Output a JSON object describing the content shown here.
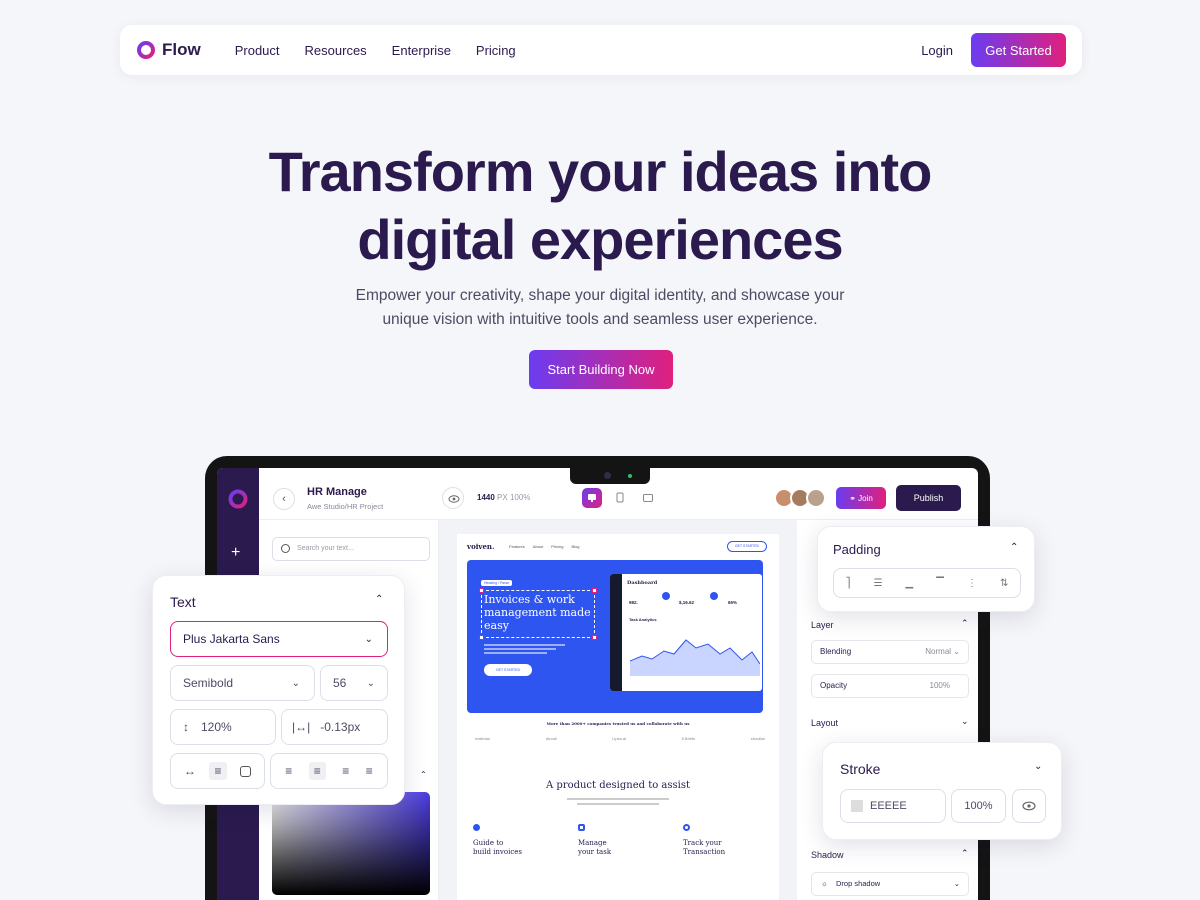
{
  "nav": {
    "brand": "Flow",
    "links": [
      "Product",
      "Resources",
      "Enterprise",
      "Pricing"
    ],
    "login": "Login",
    "cta": "Get Started"
  },
  "hero": {
    "title_line1": "Transform your ideas into",
    "title_line2": "digital experiences",
    "subtitle_line1": "Empower your creativity, shape your digital identity, and showcase your",
    "subtitle_line2": "unique vision with intuitive tools and seamless user experience.",
    "cta": "Start Building Now"
  },
  "editor": {
    "project_title": "HR Manage",
    "project_path": "Awe Studio/HR Project",
    "width_value": "1440",
    "width_unit": "PX",
    "zoom": "100%",
    "join": "Join",
    "publish": "Publish",
    "search_placeholder": "Search your text...",
    "right": {
      "layer": "Layer",
      "blending_label": "Blending",
      "blending_value": "Normal",
      "opacity_label": "Opacity",
      "opacity_value": "100%",
      "layout": "Layout",
      "shadow": "Shadow",
      "drop_shadow": "Drop shadow"
    },
    "site": {
      "brand": "voiven.",
      "nav": [
        "Features",
        "About",
        "Pricing",
        "Blog"
      ],
      "nav_cta": "GET STARTED",
      "tag": "Heading / Parse",
      "hero_title": "Invoices & work management made easy",
      "hero_cta": "GET STARTED",
      "dash_title": "Dashboard",
      "dash_stats": [
        "982.",
        "$,16.62",
        "65%"
      ],
      "task": "Task Analytics",
      "trusted": "More than 2000+ companies trusted us and collaborate with us",
      "logos": [
        "mailman",
        "Aircall",
        "Lipsa.ai",
        "5 Briefs",
        "shoutlar"
      ],
      "section_title": "A product designed to assist",
      "features": [
        {
          "title_1": "Guide to",
          "title_2": "build invoices"
        },
        {
          "title_1": "Manage",
          "title_2": "your task"
        },
        {
          "title_1": "Track your",
          "title_2": "Transaction"
        }
      ]
    }
  },
  "text_panel": {
    "title": "Text",
    "font": "Plus Jakarta Sans",
    "weight": "Semibold",
    "size": "56",
    "line_height": "120%",
    "letter_spacing": "-0.13px"
  },
  "padding_panel": {
    "title": "Padding"
  },
  "stroke_panel": {
    "title": "Stroke",
    "color": "EEEEE",
    "opacity": "100%"
  },
  "colors": {
    "primary": "#2a1a4e",
    "gradient_start": "#6b3cf0",
    "gradient_end": "#e0207d",
    "blue": "#2f55f0"
  }
}
